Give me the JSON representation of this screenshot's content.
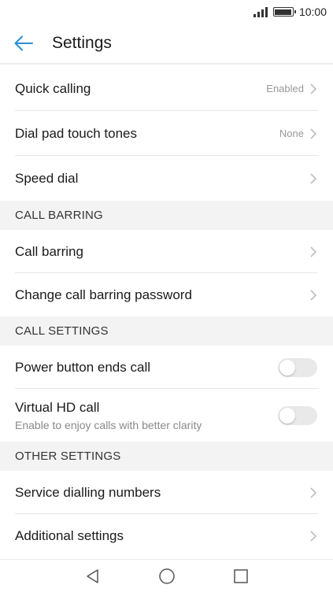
{
  "status_bar": {
    "time": "10:00",
    "signal_icon": "signal-icon",
    "battery_icon": "battery-icon"
  },
  "app_bar": {
    "title": "Settings",
    "back_icon": "back-arrow-icon"
  },
  "colors": {
    "accent": "#2a8fd6",
    "section_bg": "#f3f3f3",
    "divider": "#e6e6e6",
    "secondary_text": "#8a8a8a",
    "toggle_off": "#e9e9e9"
  },
  "rows_top": [
    {
      "label": "Quick calling",
      "value": "Enabled"
    },
    {
      "label": "Dial pad touch tones",
      "value": "None"
    },
    {
      "label": "Speed dial",
      "value": ""
    }
  ],
  "sections": [
    {
      "header": "CALL BARRING",
      "rows": [
        {
          "label": "Call barring"
        },
        {
          "label": "Change call barring password"
        }
      ]
    },
    {
      "header": "CALL SETTINGS",
      "rows": [
        {
          "label": "Power button ends call",
          "toggle": false
        },
        {
          "label": "Virtual HD call",
          "sub": "Enable to enjoy calls with better clarity",
          "toggle": false
        }
      ]
    },
    {
      "header": "OTHER SETTINGS",
      "rows": [
        {
          "label": "Service dialling numbers"
        },
        {
          "label": "Additional settings"
        }
      ]
    }
  ],
  "nav_bar": {
    "back_icon": "nav-back-icon",
    "home_icon": "nav-home-icon",
    "recents_icon": "nav-recents-icon"
  }
}
